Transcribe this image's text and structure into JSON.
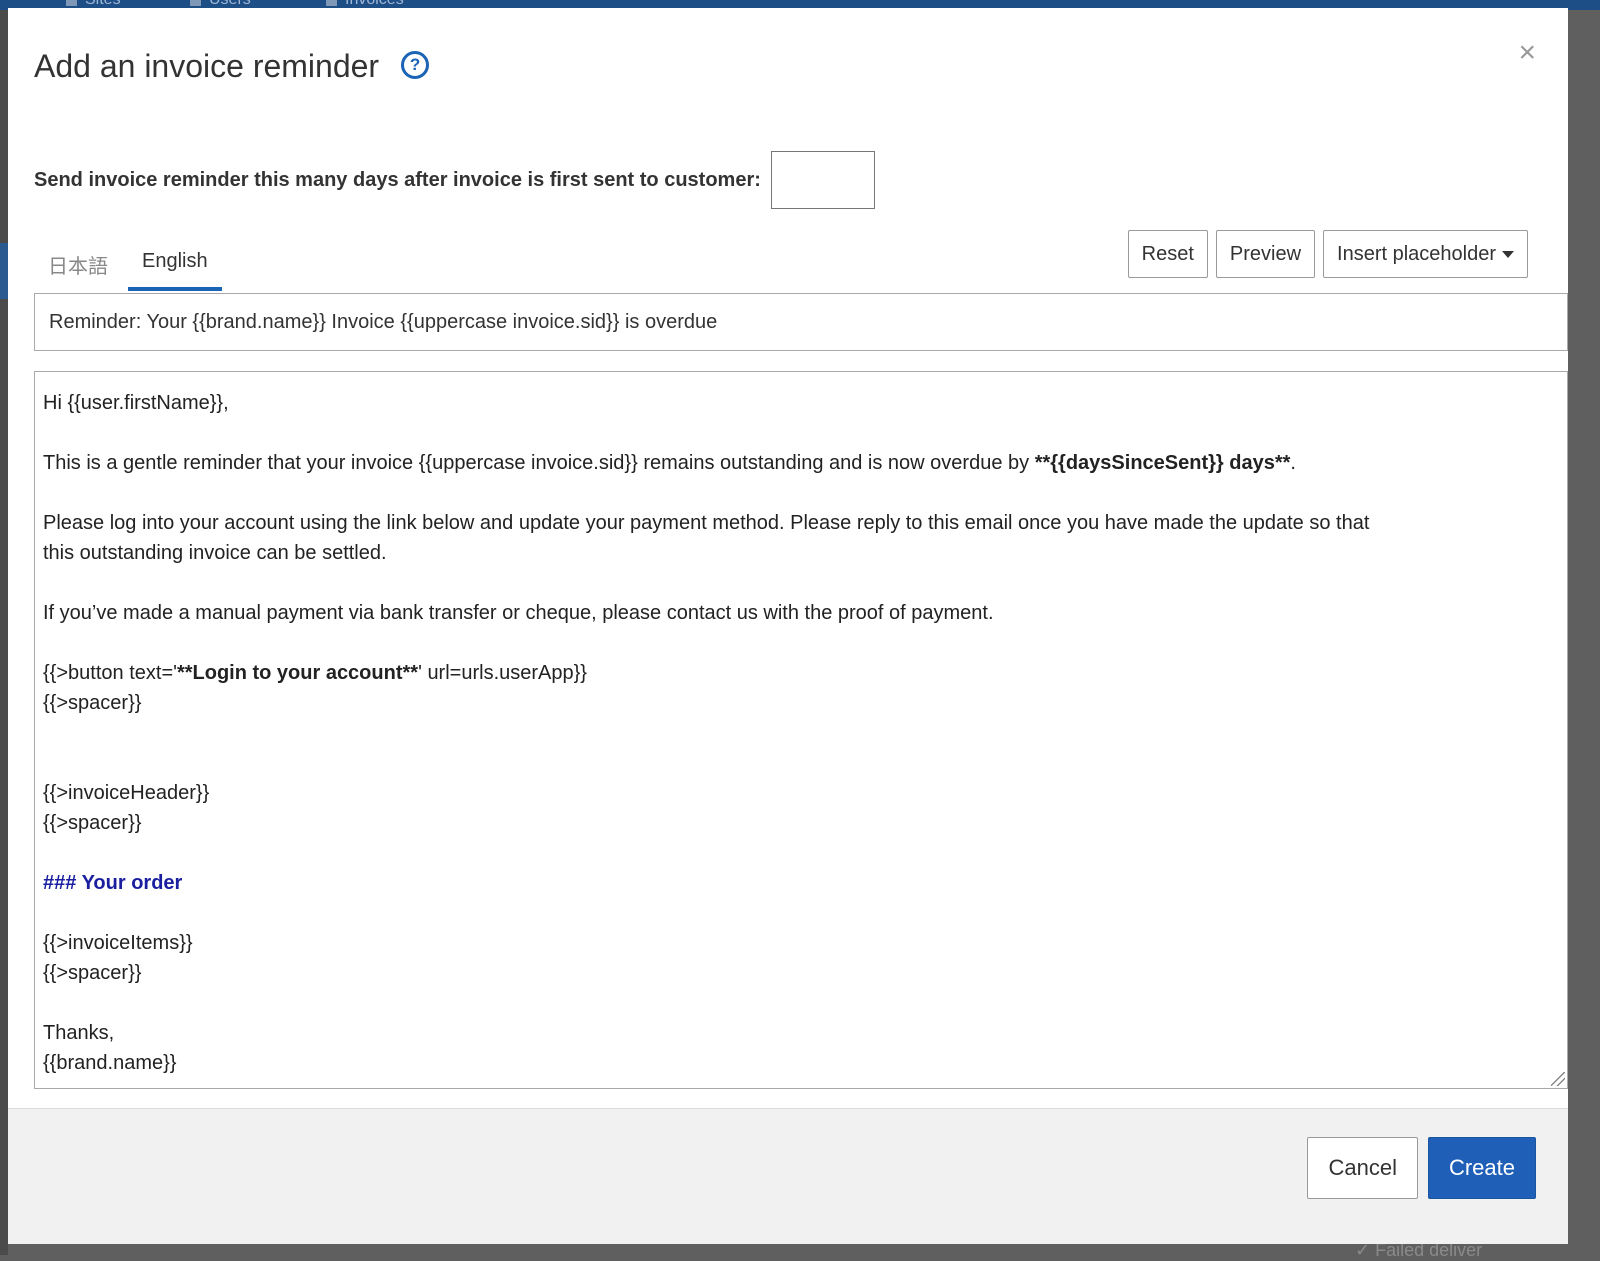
{
  "background": {
    "nav_items": [
      "Sites",
      "Users",
      "Invoices"
    ],
    "bottom_text": "✓ Failed deliver"
  },
  "modal": {
    "title": "Add an invoice reminder",
    "close_label": "×",
    "help_label": "?",
    "days_label": "Send invoice reminder this many days after invoice is first sent to customer:",
    "days_value": "",
    "tabs": [
      {
        "label": "日本語",
        "active": false
      },
      {
        "label": "English",
        "active": true
      }
    ],
    "toolbar": {
      "reset": "Reset",
      "preview": "Preview",
      "insert_placeholder": "Insert placeholder"
    },
    "subject": "Reminder: Your {{brand.name}} Invoice {{uppercase invoice.sid}} is overdue",
    "body": {
      "greeting": "Hi {{user.firstName}},",
      "para1_prefix": "This is a gentle reminder that your invoice {{uppercase invoice.sid}} remains outstanding and is now overdue by ",
      "para1_bold": "**{{daysSinceSent}} days**",
      "para1_suffix": ".",
      "para2_line1": "Please log into your account using the link below and update your payment method. Please reply to this email once you have made the update so that",
      "para2_line2": "this outstanding invoice can be settled.",
      "para3": "If you’ve made a manual payment via bank transfer or cheque, please contact us with the proof of payment.",
      "button_prefix": "{{>button text='",
      "button_bold": "**Login to your account**",
      "button_suffix": "' url=urls.userApp}}",
      "spacer1": "{{>spacer}}",
      "invoice_header": "{{>invoiceHeader}}",
      "spacer2": "{{>spacer}}",
      "heading": "### Your order",
      "invoice_items": "{{>invoiceItems}}",
      "spacer3": "{{>spacer}}",
      "thanks": "Thanks,",
      "signature": "{{brand.name}}"
    },
    "footer": {
      "cancel": "Cancel",
      "create": "Create"
    }
  },
  "colors": {
    "accent": "#1f5fb8",
    "heading_text": "#1a1fa0",
    "nav_bg": "#1e4e86"
  }
}
